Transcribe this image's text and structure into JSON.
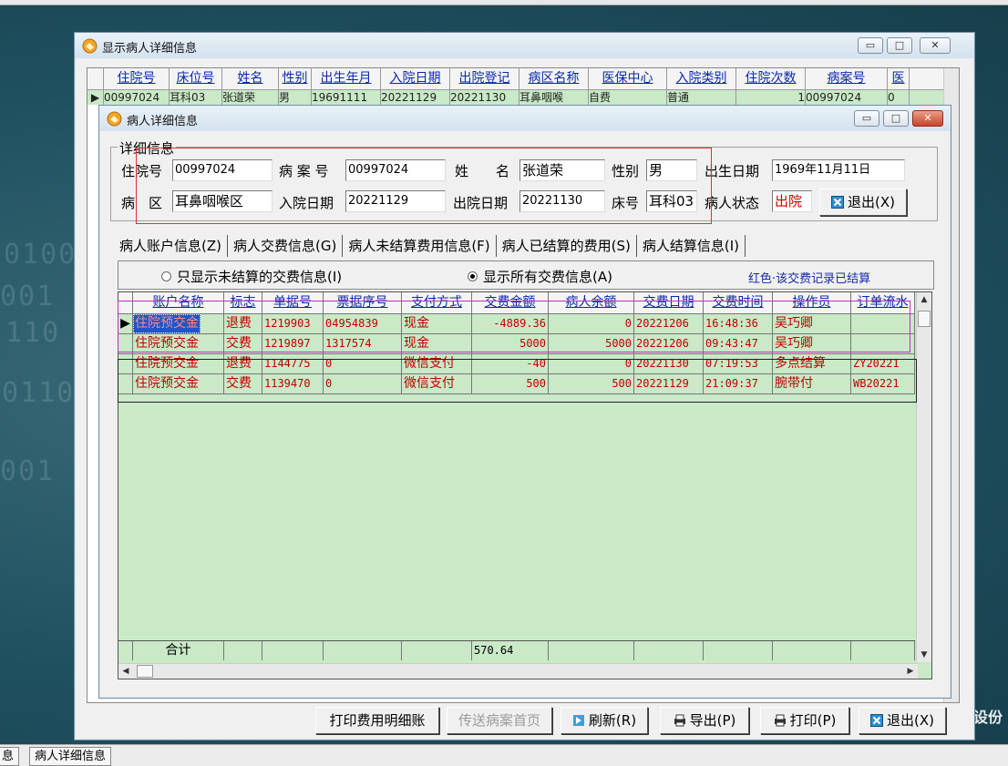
{
  "desktop": {
    "side_text": "设份"
  },
  "outer_window": {
    "title": "显示病人详细信息",
    "columns": [
      "住院号",
      "床位号",
      "姓名",
      "性别",
      "出生年月",
      "入院日期",
      "出院登记",
      "病区名称",
      "医保中心",
      "入院类别",
      "住院次数",
      "病案号",
      "医"
    ],
    "row": [
      "00997024",
      "耳科03",
      "张道荣",
      "男",
      "19691111",
      "20221129",
      "20221130",
      "耳鼻咽喉",
      "自费",
      "普通",
      "1",
      "00997024",
      "0"
    ]
  },
  "dialog": {
    "title": "病人详细信息",
    "group_label": "详细信息",
    "fields": {
      "inpatient_no_label": "住院号",
      "inpatient_no": "00997024",
      "case_no_label": "病 案 号",
      "case_no": "00997024",
      "name_label": "姓　　名",
      "name": "张道荣",
      "gender_label": "性别",
      "gender": "男",
      "birth_label": "出生日期",
      "birth": "1969年11月11日",
      "ward_label": "病　区",
      "ward": "耳鼻咽喉区",
      "admit_label": "入院日期",
      "admit": "20221129",
      "discharge_label": "出院日期",
      "discharge": "20221130",
      "bed_label": "床号",
      "bed": "耳科03",
      "status_label": "病人状态",
      "status": "出院",
      "exit_top_label": "退出(X)"
    },
    "tabs": [
      "病人账户信息(Z)",
      "病人交费信息(G)",
      "病人未结算费用信息(F)",
      "病人已结算的费用(S)",
      "病人结算信息(I)"
    ],
    "radio_unsettled": "只显示未结算的交费信息(I)",
    "radio_all": "显示所有交费信息(A)",
    "legend_note": "红色·该交费记录已结算",
    "grid_columns": [
      "账户名称",
      "标志",
      "单据号",
      "票据序号",
      "支付方式",
      "交费金额",
      "病人余额",
      "交费日期",
      "交费时间",
      "操作员",
      "订单流水"
    ],
    "grid_rows": [
      [
        "住院预交金",
        "退费",
        "1219903",
        "04954839",
        "现金",
        "-4889.36",
        "0",
        "20221206",
        "16:48:36",
        "吴巧卿",
        ""
      ],
      [
        "住院预交金",
        "交费",
        "1219897",
        "1317574",
        "现金",
        "5000",
        "5000",
        "20221206",
        "09:43:47",
        "吴巧卿",
        ""
      ],
      [
        "住院预交金",
        "退费",
        "1144775",
        "0",
        "微信支付",
        "-40",
        "0",
        "20221130",
        "07:19:53",
        "多点结算",
        "ZY20221"
      ],
      [
        "住院预交金",
        "交费",
        "1139470",
        "0",
        "微信支付",
        "500",
        "500",
        "20221129",
        "21:09:37",
        "腕带付",
        "WB20221"
      ]
    ],
    "total_label": "合计",
    "total_value": "570.64",
    "buttons": {
      "print_detail": "打印费用明细账",
      "send_case": "传送病案首页",
      "refresh": "刷新(R)",
      "export": "导出(P)",
      "print": "打印(P)",
      "exit": "退出(X)"
    }
  },
  "taskbar": {
    "item1": "息",
    "item2": "病人详细信息"
  },
  "colors": {
    "grid_bg": "#c9e9c7",
    "settled_text": "#c00000",
    "header_text": "#0a2aa8",
    "selection": "#1e55c8"
  }
}
